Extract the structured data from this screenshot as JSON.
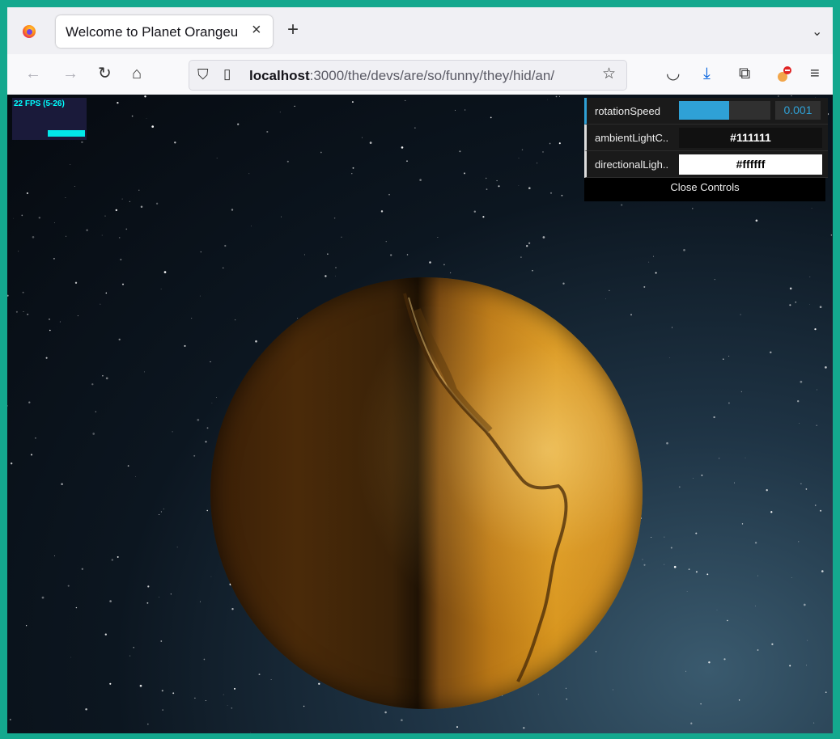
{
  "browser": {
    "tab_title": "Welcome to Planet Orangeu",
    "tab_close": "×",
    "new_tab": "+",
    "tab_list": "⌄",
    "url_host": "localhost",
    "url_rest": ":3000/the/devs/are/so/funny/they/hid/an/"
  },
  "stats": {
    "fps_label": "22 FPS (5-26)"
  },
  "gui": {
    "rows": [
      {
        "label": "rotationSpeed",
        "value": "0.001",
        "slider_fraction": 0.55,
        "accent": "#2fa1d6"
      },
      {
        "label": "ambientLightC..",
        "value": "#111111",
        "swatch": "#111111",
        "text_color": "#ffffff"
      },
      {
        "label": "directionalLigh..",
        "value": "#ffffff",
        "swatch": "#ffffff",
        "text_color": "#000000"
      }
    ],
    "close_label": "Close Controls"
  },
  "colors": {
    "planet_light": "#d8961f",
    "planet_dark": "#3a1f07",
    "frame": "#14a88e"
  }
}
